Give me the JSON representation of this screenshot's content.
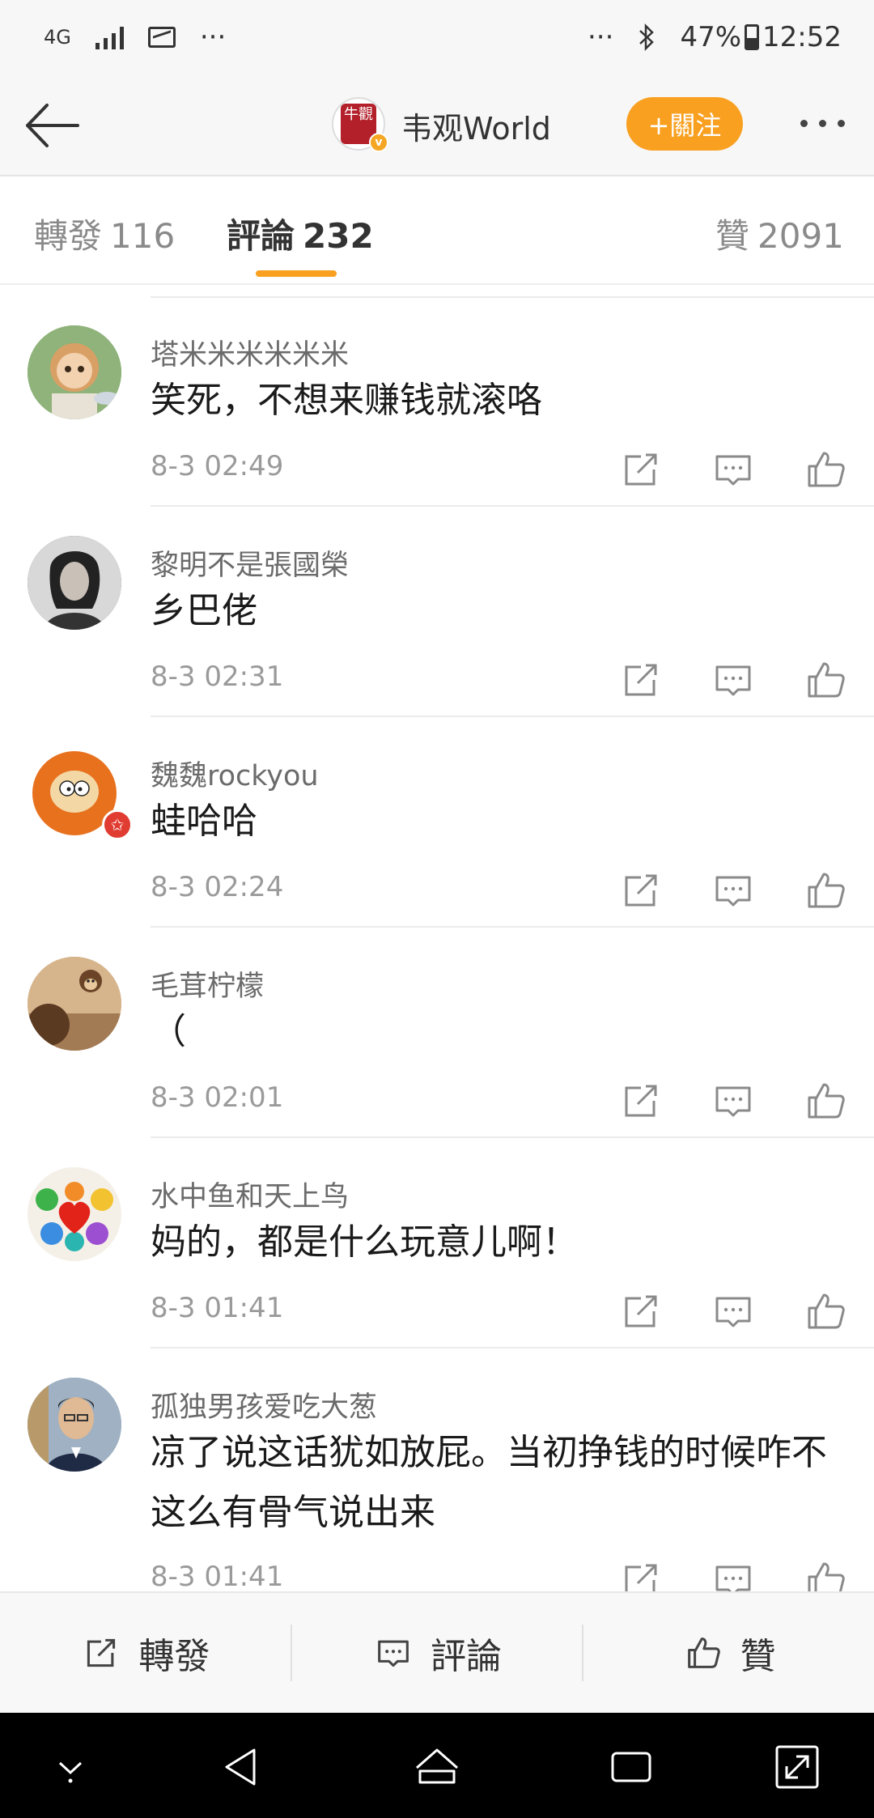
{
  "status_bar": {
    "network": "4G",
    "more": "···",
    "right_more": "···",
    "battery": "47%",
    "time": "12:52"
  },
  "header": {
    "account_name": "韦观World",
    "avatar_seal_text": "牛觀",
    "follow_label": "+關注"
  },
  "tabs": [
    {
      "label": "轉發",
      "count": "116"
    },
    {
      "label": "評論",
      "count": "232"
    },
    {
      "label": "贊",
      "count": "2091"
    }
  ],
  "comments": [
    {
      "name": "塔米米米米米米",
      "text": "笑死，不想来赚钱就滚咯",
      "time": "8-3 02:49",
      "avatar": "doll-avatar"
    },
    {
      "name": "黎明不是張國榮",
      "text": "乡巴佬",
      "time": "8-3 02:31",
      "avatar": "portrait-avatar"
    },
    {
      "name": "魏魏rockyou",
      "text": "蛙哈哈",
      "time": "8-3 02:24",
      "avatar": "cartoon-avatar"
    },
    {
      "name": "毛茸柠檬",
      "text": "（",
      "time": "8-3 02:01",
      "avatar": "monkey-avatar"
    },
    {
      "name": "水中鱼和天上鸟",
      "text": "妈的，都是什么玩意儿啊！",
      "time": "8-3 01:41",
      "avatar": "hearts-avatar"
    },
    {
      "name": "孤独男孩爱吃大葱",
      "text": "凉了说这话犹如放屁。当初挣钱的时候咋不这么有骨气说出来",
      "time": "8-3 01:41",
      "avatar": "man-avatar"
    }
  ],
  "bottom_bar": {
    "repost": "轉發",
    "comment": "評論",
    "like": "贊"
  },
  "colors": {
    "accent": "#f9a020",
    "name_gray": "#6b6b6b",
    "time_gray": "#9a9a9a"
  }
}
